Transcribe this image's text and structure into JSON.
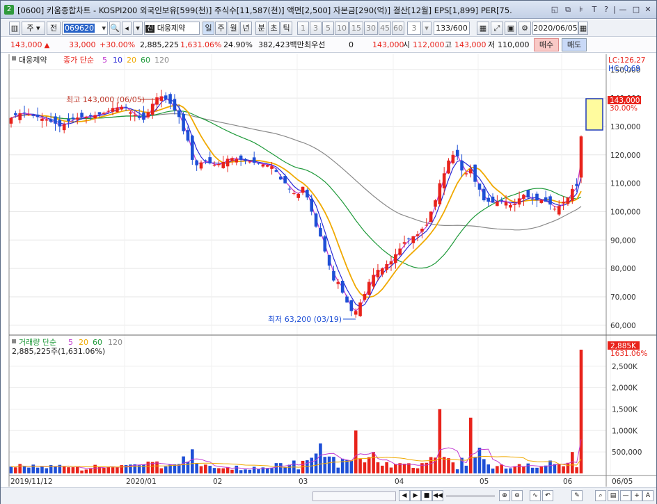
{
  "window": {
    "badge": "2",
    "title": "[0600] 키움종합차트 - KOSPI200 외국인보유[599(천)] 주식수[11,587(천)] 액면[2,500] 자본금[290(억)] 결산[12월] EPS[1,899] PER[75.",
    "controls": [
      "◱",
      "⧉",
      "⊧",
      "T",
      "?",
      "|",
      "—",
      "□",
      "✕"
    ]
  },
  "toolbar": {
    "mode1": "주",
    "mode2": "전",
    "code": "069620",
    "stock_badge": "신",
    "stock_name": "대웅제약",
    "periods": [
      "일",
      "주",
      "월",
      "년",
      "분",
      "초",
      "틱"
    ],
    "intervals": [
      "1",
      "3",
      "5",
      "10",
      "15",
      "30",
      "45",
      "60"
    ],
    "custom_interval": "3",
    "count": "133/600",
    "date": "2020/06/05"
  },
  "quote": {
    "price": "143,000",
    "change": "33,000",
    "change_pct": "+30.00%",
    "volume": "2,885,225",
    "volume_ratio": "1,631.06%",
    "turnover": "24.90%",
    "amount": "382,423백만",
    "priority_label": "최우선",
    "priority_value": "0",
    "current": "143,000",
    "open_label": "시",
    "open": "112,000",
    "high_label": "고",
    "high": "143,000",
    "low_label": "저",
    "low": "110,000",
    "buy": "매수",
    "sell": "매도"
  },
  "legend": {
    "name": "대웅제약",
    "series_label": "종가 단순",
    "ma": [
      "5",
      "10",
      "20",
      "60",
      "120"
    ],
    "vol_label": "거래량 단순",
    "vol_text": "2,885,225주(1,631.06%)"
  },
  "annotations": {
    "high": "최고 143,000 (06/05)",
    "low": "최저 63,200 (03/19)",
    "lc": "LC:126,27",
    "hc": "HC:-0,69",
    "price_tag": "143,000",
    "pct_tag": "30.00%",
    "vol_tag": "2,885K",
    "vol_pct_tag": "1631.06%"
  },
  "colors": {
    "up": "#e8231b",
    "down": "#1e4fd6",
    "ma5": "#c23bd1",
    "ma10": "#2a2ad8",
    "ma20": "#f0a900",
    "ma60": "#1f9a3a",
    "ma120": "#8a8a8a"
  },
  "chart_data": {
    "type": "candlestick",
    "price_axis": [
      "150,000",
      "140,000",
      "130,000",
      "120,000",
      "110,000",
      "100,000",
      "90,000",
      "80,000",
      "70,000",
      "60,000"
    ],
    "volume_axis": [
      "2,500K",
      "2,000K",
      "1,500K",
      "1,000K",
      "500,000"
    ],
    "x_labels": [
      "2019/11/12",
      "2020/01",
      "02",
      "03",
      "04",
      "05",
      "06",
      "06/05"
    ],
    "ylim": [
      58000,
      153000
    ],
    "vol_max": 2885225
  },
  "statusbar": {
    "buttons": [
      "◀",
      "▶",
      "■",
      "◀◀",
      "▶▶",
      "—",
      "+",
      "A"
    ]
  }
}
